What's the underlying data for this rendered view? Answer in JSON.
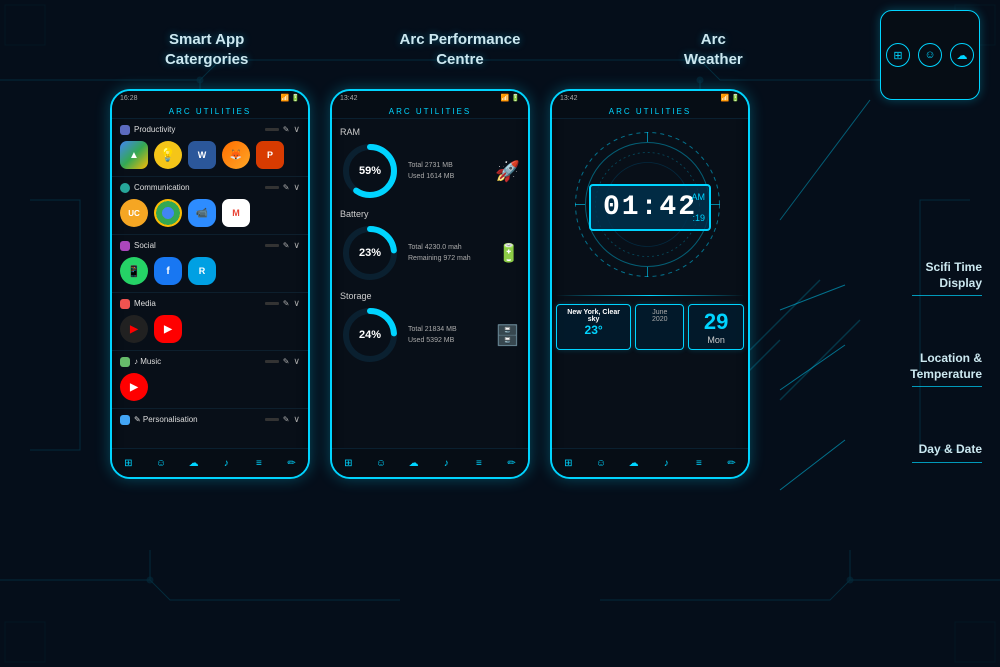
{
  "background": {
    "color": "#050e1a"
  },
  "sections": [
    {
      "id": "smart-app",
      "label": "Smart App\nCatergories"
    },
    {
      "id": "arc-performance",
      "label": "Arc Performance\nCentre"
    },
    {
      "id": "arc-weather",
      "label": "Arc\nWeather"
    }
  ],
  "phone1": {
    "status": "16:28",
    "title": "ARC UTILITIES",
    "categories": [
      {
        "name": "Productivity",
        "apps": [
          "G",
          "💡",
          "W",
          "🦊",
          "P"
        ]
      },
      {
        "name": "Communication",
        "apps": [
          "UC",
          "C",
          "Z",
          "M"
        ]
      },
      {
        "name": "Social",
        "apps": [
          "W",
          "f",
          "R"
        ]
      },
      {
        "name": "Media",
        "apps": [
          "▶",
          "▶"
        ]
      },
      {
        "name": "Music",
        "apps": [
          "▶"
        ]
      },
      {
        "name": "Personalisation",
        "apps": []
      }
    ]
  },
  "phone2": {
    "status": "13:42",
    "title": "ARC UTILITIES",
    "ram": {
      "label": "RAM",
      "total": "Total 2731 MB",
      "used": "Used 1614 MB",
      "percent": 59,
      "percent_label": "59%"
    },
    "battery": {
      "label": "Battery",
      "total": "Total 4230.0 mah",
      "remaining": "Remaining 972 mah",
      "percent": 23,
      "percent_label": "23%"
    },
    "storage": {
      "label": "Storage",
      "total": "Total 21834 MB",
      "used": "Used 5392 MB",
      "percent": 24,
      "percent_label": "24%"
    }
  },
  "phone3": {
    "status": "13:42",
    "title": "ARC UTILITIES",
    "clock": {
      "time": "01:42",
      "ampm": "AM",
      "seconds": ":19"
    },
    "weather": {
      "city": "New York, Clear sky",
      "temp": "23°"
    },
    "date": {
      "month": "June",
      "year": "2020",
      "day_num": "29",
      "day_name": "Mon"
    }
  },
  "annotations": [
    {
      "id": "scifi-time",
      "label": "Scifi Time\nDisplay"
    },
    {
      "id": "location-temp",
      "label": "Location &\nTemperature"
    },
    {
      "id": "day-date",
      "label": "Day & Date"
    }
  ],
  "nav_icons": [
    "⊞",
    "☺",
    "☁",
    "♪",
    "≡",
    "✏"
  ]
}
